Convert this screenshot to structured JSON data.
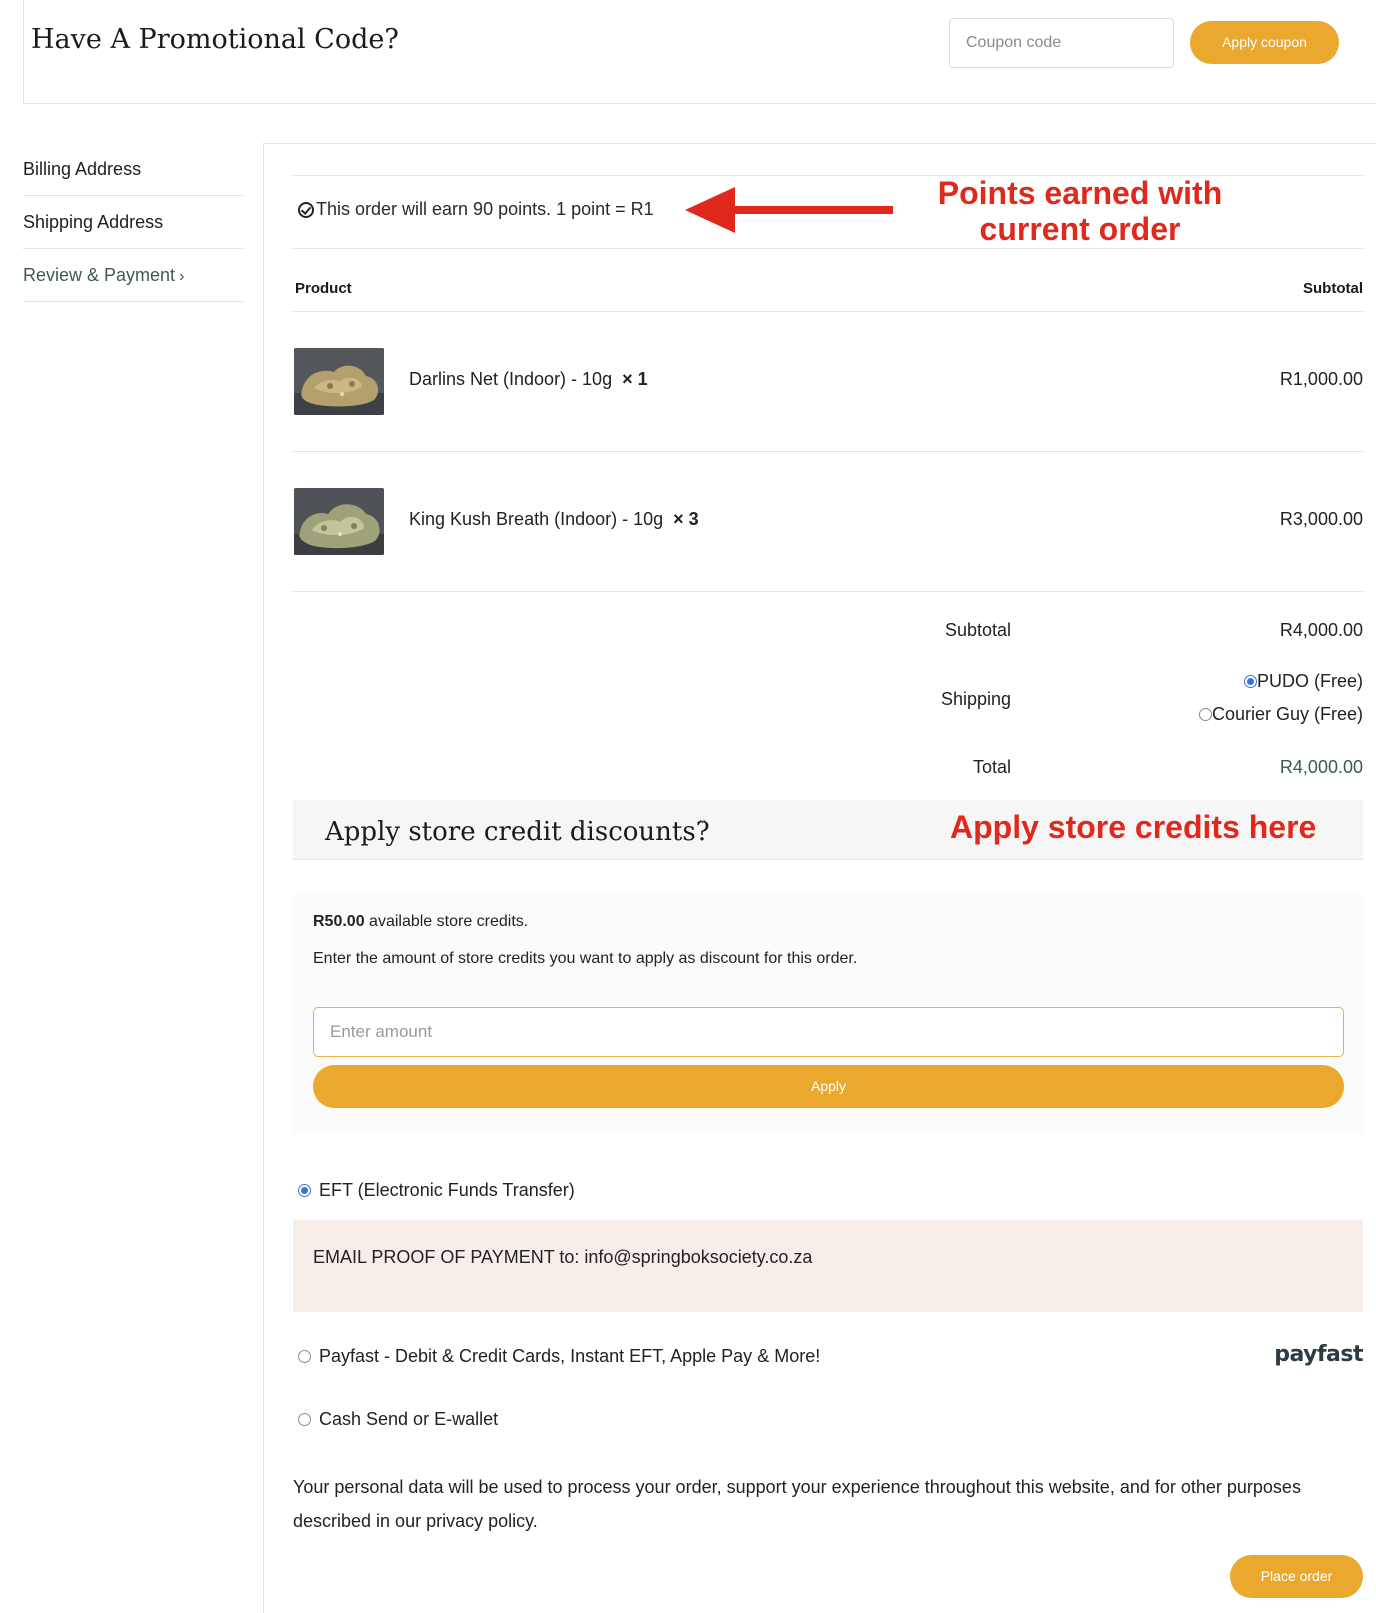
{
  "promo": {
    "title": "Have A Promotional Code?",
    "coupon_placeholder": "Coupon code",
    "apply_label": "Apply coupon"
  },
  "steps": [
    {
      "label": "Billing Address",
      "active": false
    },
    {
      "label": "Shipping Address",
      "active": false
    },
    {
      "label": "Review & Payment",
      "active": true
    }
  ],
  "points": {
    "text": "This order will earn 90 points. 1 point = R1",
    "icon": "check-circle-icon"
  },
  "annotations": {
    "points_note": "Points earned with current order",
    "credits_note": "Apply store credits here",
    "arrow_color": "#e0291c"
  },
  "table": {
    "product_header": "Product",
    "subtotal_header": "Subtotal",
    "items": [
      {
        "name": "Darlins Net (Indoor) - 10g",
        "qty": "× 1",
        "price": "R1,000.00"
      },
      {
        "name": "King Kush Breath (Indoor) - 10g",
        "qty": "× 3",
        "price": "R3,000.00"
      }
    ]
  },
  "totals": {
    "subtotal_label": "Subtotal",
    "subtotal_value": "R4,000.00",
    "shipping_label": "Shipping",
    "shipping_options": [
      {
        "label": "PUDO (Free)",
        "selected": true
      },
      {
        "label": "Courier Guy (Free)",
        "selected": false
      }
    ],
    "total_label": "Total",
    "total_value": "R4,000.00"
  },
  "store_credit": {
    "title": "Apply store credit discounts?",
    "available_amount": "R50.00",
    "available_text": " available store credits.",
    "help_text": "Enter the amount of store credits you want to apply as discount for this order.",
    "amount_placeholder": "Enter amount",
    "apply_label": "Apply"
  },
  "payment": {
    "eft_label": "EFT (Electronic Funds Transfer)",
    "eft_instructions": "EMAIL PROOF OF PAYMENT to: info@springboksociety.co.za",
    "payfast_label": "Payfast - Debit & Credit Cards, Instant EFT, Apple Pay & More!",
    "payfast_logo": "payfast",
    "cash_label": "Cash Send or E-wallet",
    "selected": "eft"
  },
  "privacy_text": "Your personal data will be used to process your order, support your experience throughout this website, and for other purposes described in our privacy policy.",
  "place_order_label": "Place order",
  "colors": {
    "accent": "#eaa82e",
    "link_green": "#3d5c4a",
    "annotation_red": "#e0291c"
  }
}
